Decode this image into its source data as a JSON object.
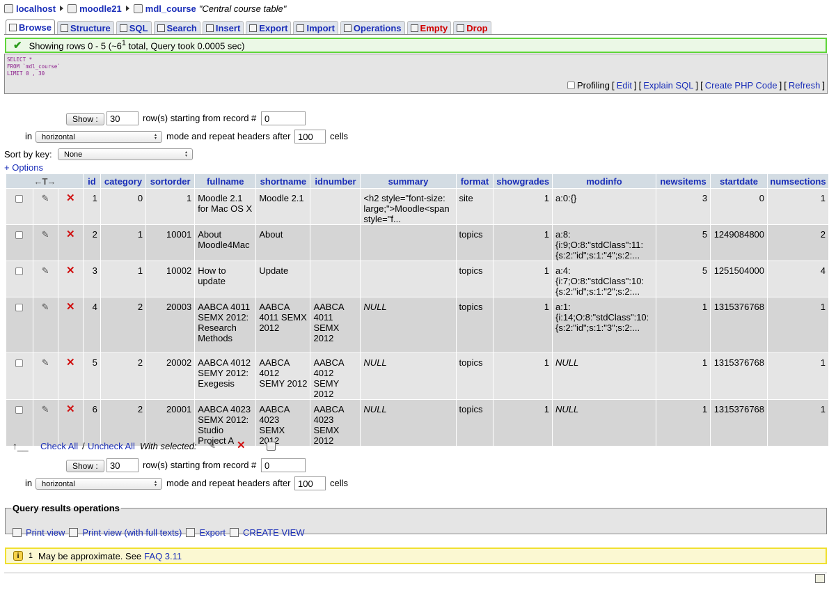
{
  "breadcrumb": {
    "server": "localhost",
    "database": "moodle21",
    "table": "mdl_course",
    "comment": "\"Central course table\""
  },
  "tabs": [
    {
      "label": "Browse",
      "icon": "browse-icon",
      "active": true
    },
    {
      "label": "Structure",
      "icon": "structure-icon"
    },
    {
      "label": "SQL",
      "icon": "sql-icon"
    },
    {
      "label": "Search",
      "icon": "search-icon"
    },
    {
      "label": "Insert",
      "icon": "insert-icon"
    },
    {
      "label": "Export",
      "icon": "export-icon"
    },
    {
      "label": "Import",
      "icon": "import-icon"
    },
    {
      "label": "Operations",
      "icon": "operations-icon"
    },
    {
      "label": "Empty",
      "icon": "empty-icon",
      "danger": true
    },
    {
      "label": "Drop",
      "icon": "drop-icon",
      "danger": true
    }
  ],
  "message": {
    "text_before": "Showing rows 0 - 5 (~6",
    "sup": "1",
    "text_after": " total, Query took 0.0005 sec)"
  },
  "sql": {
    "line1": "SELECT *",
    "line2": "FROM `mdl_course`",
    "line3": "LIMIT 0 , 30"
  },
  "sql_links": {
    "profiling": "Profiling",
    "edit": "Edit",
    "explain": "Explain SQL",
    "php": "Create PHP Code",
    "refresh": "Refresh"
  },
  "nav_top": {
    "show_label": "Show :",
    "rows": "30",
    "rows_text": "row(s) starting from record #",
    "start": "0",
    "in_label": "in",
    "mode": "horizontal",
    "mode_text": "mode and repeat headers after",
    "repeat": "100",
    "cells": "cells"
  },
  "sort": {
    "label": "Sort by key:",
    "value": "None"
  },
  "options_link": "+ Options",
  "columns": [
    "id",
    "category",
    "sortorder",
    "fullname",
    "shortname",
    "idnumber",
    "summary",
    "format",
    "showgrades",
    "modinfo",
    "newsitems",
    "startdate",
    "numsections"
  ],
  "rows": [
    {
      "id": "1",
      "category": "0",
      "sortorder": "1",
      "fullname": "Moodle 2.1 for Mac OS X",
      "shortname": "Moodle 2.1",
      "idnumber": "",
      "summary": "<h2 style=\"font-size: large;\">Moodle<span style=\"f...",
      "format": "site",
      "showgrades": "1",
      "modinfo": "a:0:{}",
      "newsitems": "3",
      "startdate": "0",
      "numsections": "1"
    },
    {
      "id": "2",
      "category": "1",
      "sortorder": "10001",
      "fullname": "About Moodle4Mac",
      "shortname": "About",
      "idnumber": "",
      "summary": "",
      "format": "topics",
      "showgrades": "1",
      "modinfo": "a:8: {i:9;O:8:\"stdClass\":11: {s:2:\"id\";s:1:\"4\";s:2:...",
      "newsitems": "5",
      "startdate": "1249084800",
      "numsections": "2"
    },
    {
      "id": "3",
      "category": "1",
      "sortorder": "10002",
      "fullname": "How to update",
      "shortname": "Update",
      "idnumber": "",
      "summary": "",
      "format": "topics",
      "showgrades": "1",
      "modinfo": "a:4: {i:7;O:8:\"stdClass\":10: {s:2:\"id\";s:1:\"2\";s:2:...",
      "newsitems": "5",
      "startdate": "1251504000",
      "numsections": "4"
    },
    {
      "id": "4",
      "category": "2",
      "sortorder": "20003",
      "fullname": "AABCA 4011 SEMX 2012: Research Methods",
      "shortname": "AABCA 4011 SEMX 2012",
      "idnumber": "AABCA 4011 SEMX 2012",
      "summary": "NULL",
      "format": "topics",
      "showgrades": "1",
      "modinfo": "a:1: {i:14;O:8:\"stdClass\":10: {s:2:\"id\";s:1:\"3\";s:2:...",
      "newsitems": "1",
      "startdate": "1315376768",
      "numsections": "1"
    },
    {
      "id": "5",
      "category": "2",
      "sortorder": "20002",
      "fullname": "AABCA 4012 SEMY 2012: Exegesis",
      "shortname": "AABCA 4012 SEMY 2012",
      "idnumber": "AABCA 4012 SEMY 2012",
      "summary": "NULL",
      "format": "topics",
      "showgrades": "1",
      "modinfo": "NULL",
      "newsitems": "1",
      "startdate": "1315376768",
      "numsections": "1"
    },
    {
      "id": "6",
      "category": "2",
      "sortorder": "20001",
      "fullname": "AABCA 4023 SEMX 2012: Studio Project A",
      "shortname": "AABCA 4023 SEMX 2012",
      "idnumber": "AABCA 4023 SEMX 2012",
      "summary": "NULL",
      "format": "topics",
      "showgrades": "1",
      "modinfo": "NULL",
      "newsitems": "1",
      "startdate": "1315376768",
      "numsections": "1"
    }
  ],
  "bulk": {
    "check_all": "Check All",
    "sep": "/",
    "uncheck_all": "Uncheck All",
    "with_selected": "With selected:"
  },
  "nav_bottom": {
    "show_label": "Show :",
    "rows": "30",
    "rows_text": "row(s) starting from record #",
    "start": "0",
    "in_label": "in",
    "mode": "horizontal",
    "mode_text": "mode and repeat headers after",
    "repeat": "100",
    "cells": "cells"
  },
  "qro": {
    "legend": "Query results operations",
    "print": "Print view",
    "print_full": "Print view (with full texts)",
    "export": "Export",
    "create_view": "CREATE VIEW"
  },
  "notice": {
    "sup": "1",
    "text": "May be approximate. See",
    "link": "FAQ 3.11"
  },
  "colors": {
    "success_border": "#5fd63a",
    "notice_border": "#f0e030",
    "header_bg": "#d3dce3",
    "link": "#1a2eb8"
  }
}
